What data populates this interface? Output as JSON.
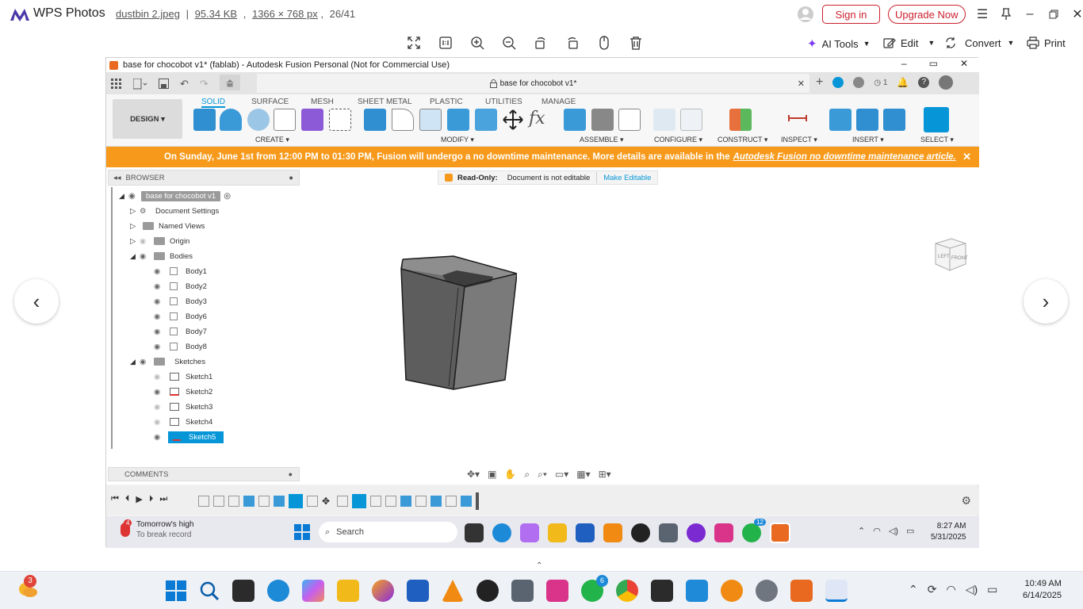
{
  "wps": {
    "app_name": "WPS Photos",
    "file_name": "dustbin 2.jpeg",
    "file_size": "95.34 KB",
    "dimensions": "1366 × 768 px",
    "index": "26/41",
    "sign_in": "Sign in",
    "upgrade": "Upgrade Now",
    "ai_tools": "AI Tools",
    "edit": "Edit",
    "convert": "Convert",
    "print": "Print"
  },
  "fusion": {
    "window_title": "base for chocobot v1* (fablab) - Autodesk Fusion Personal (Not for Commercial Use)",
    "doc_tab": "base for chocobot v1*",
    "notif_count": "1",
    "design_label": "DESIGN",
    "ribbon_tabs": [
      "SOLID",
      "SURFACE",
      "MESH",
      "SHEET METAL",
      "PLASTIC",
      "UTILITIES",
      "MANAGE"
    ],
    "ribbon_groups": [
      "CREATE",
      "MODIFY",
      "ASSEMBLE",
      "CONFIGURE",
      "CONSTRUCT",
      "INSPECT",
      "INSERT",
      "SELECT"
    ],
    "banner_text": "On Sunday, June 1st from 12:00 PM to 01:30 PM, Fusion will undergo a no downtime maintenance. More details are available in the",
    "banner_link": "Autodesk Fusion no downtime maintenance article.",
    "readonly_label": "Read-Only:",
    "readonly_msg": "Document is not editable",
    "make_editable": "Make Editable",
    "browser_title": "BROWSER",
    "comments_title": "COMMENTS",
    "tree": {
      "root": "base for chocobot v1",
      "doc_settings": "Document Settings",
      "named_views": "Named Views",
      "origin": "Origin",
      "bodies": "Bodies",
      "body_items": [
        "Body1",
        "Body2",
        "Body3",
        "Body6",
        "Body7",
        "Body8"
      ],
      "sketches": "Sketches",
      "sketch_items": [
        "Sketch1",
        "Sketch2",
        "Sketch3",
        "Sketch4",
        "Sketch5"
      ]
    },
    "viewcube_left": "LEFT",
    "viewcube_front": "FRONT"
  },
  "inner_taskbar": {
    "weather_badge": "4",
    "weather_title": "Tomorrow's high",
    "weather_sub": "To break record",
    "search": "Search",
    "whatsapp_badge": "12",
    "time": "8:27 AM",
    "date": "5/31/2025"
  },
  "taskbar": {
    "weather_badge": "3",
    "whatsapp_badge": "6",
    "time": "10:49 AM",
    "date": "6/14/2025"
  },
  "colors": {
    "wps_red": "#cc1f2d",
    "banner_orange": "#f79a1b",
    "fusion_blue": "#0696d7",
    "model_gray": "#6e6e6e"
  }
}
